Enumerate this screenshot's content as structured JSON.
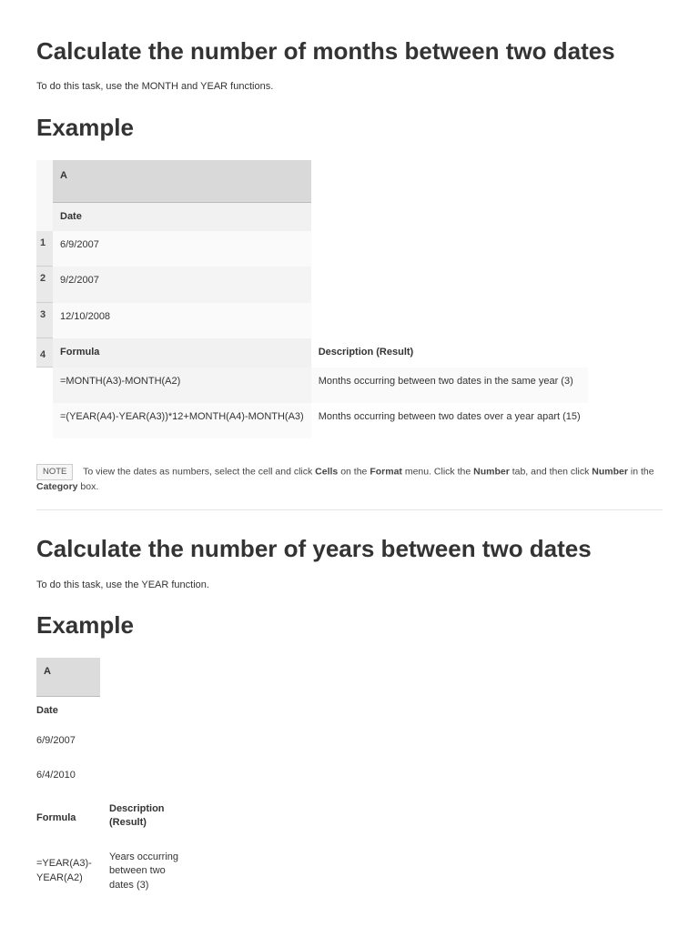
{
  "section1": {
    "heading": "Calculate the number of months between two dates",
    "intro": "To do this task, use the MONTH and YEAR functions.",
    "exampleHeading": "Example",
    "table": {
      "colA": "A",
      "rDate": "Date",
      "r1": "1",
      "v1": "6/9/2007",
      "r2": "2",
      "v2": "9/2/2007",
      "r3": "3",
      "v3": "12/10/2008",
      "r4": "4",
      "hFormula": "Formula",
      "hDesc": "Description (Result)",
      "f1": "=MONTH(A3)-MONTH(A2)",
      "d1": "Months occurring between two dates in the same year (3)",
      "f2": "=(YEAR(A4)-YEAR(A3))*12+MONTH(A4)-MONTH(A3)",
      "d2": "Months occurring between two dates over a year apart (15)"
    },
    "note": {
      "badge": "NOTE",
      "pre": "To view the dates as numbers, select the cell and click ",
      "b1": "Cells",
      "mid1": " on the ",
      "b2": "Format",
      "mid2": " menu. Click the ",
      "b3": "Number",
      "mid3": " tab, and then click ",
      "b4": "Number",
      "mid4": " in the ",
      "b5": "Category",
      "tail": " box."
    }
  },
  "section2": {
    "heading": "Calculate the number of years between two dates",
    "intro": "To do this task, use the YEAR function.",
    "exampleHeading": "Example",
    "table": {
      "colA": "A",
      "rDate": "Date",
      "v1": "6/9/2007",
      "v2": "6/4/2010",
      "hFormula": "Formula",
      "hDesc": "Description (Result)",
      "f1": "=YEAR(A3)-YEAR(A2)",
      "d1": "Years occurring between two dates (3)"
    }
  }
}
